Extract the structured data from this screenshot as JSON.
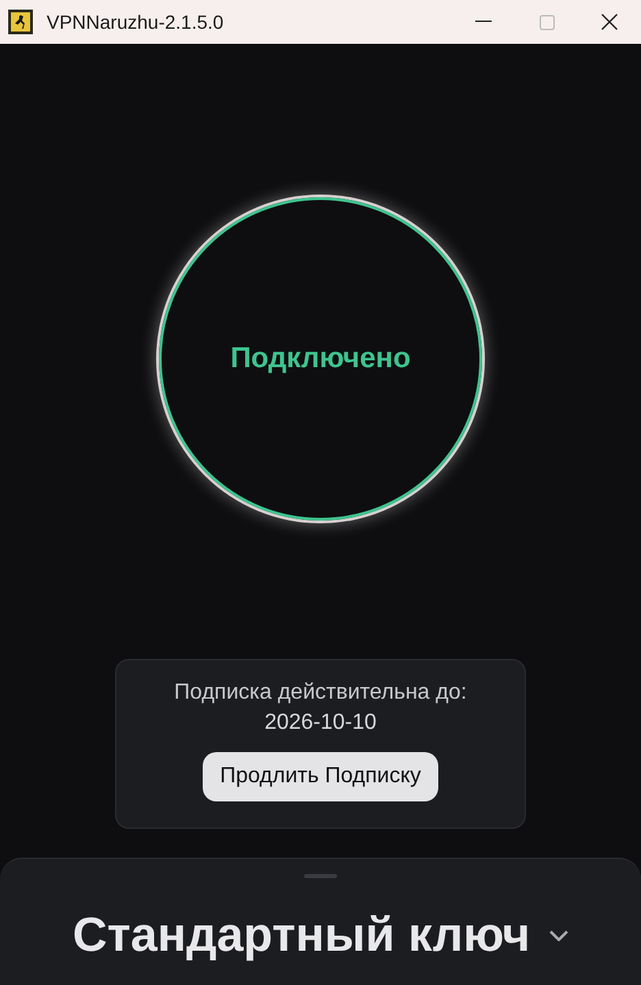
{
  "window": {
    "title": "VPNNaruzhu-2.1.5.0"
  },
  "status": {
    "label": "Подключено",
    "connected": true
  },
  "subscription": {
    "text": "Подписка действительна до:",
    "date": "2026-10-10",
    "button": "Продлить Подписку"
  },
  "key_selector": {
    "label": "Стандартный ключ"
  }
}
